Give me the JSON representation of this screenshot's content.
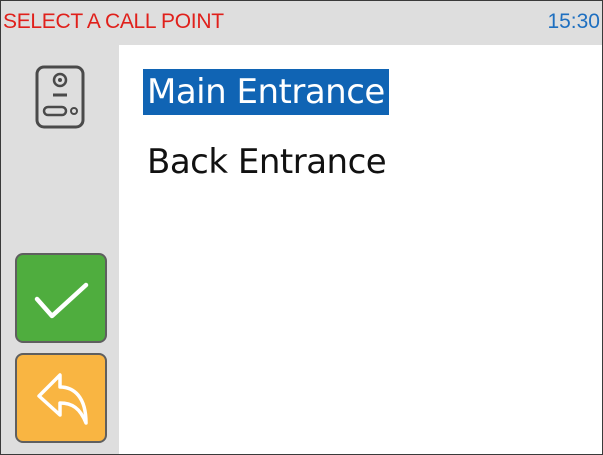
{
  "header": {
    "title": "SELECT A CALL POINT",
    "time": "15:30"
  },
  "sidebar": {
    "device_icon": "door-intercom-icon",
    "confirm_icon": "checkmark-icon",
    "back_icon": "back-arrow-icon"
  },
  "call_points": [
    {
      "label": "Main Entrance",
      "selected": true
    },
    {
      "label": "Back Entrance",
      "selected": false
    }
  ],
  "colors": {
    "header_title": "#e0201b",
    "time": "#1e6fc0",
    "panel_bg": "#dedede",
    "selection": "#1064b4",
    "confirm_button": "#4fad3e",
    "back_button": "#f9b542"
  }
}
